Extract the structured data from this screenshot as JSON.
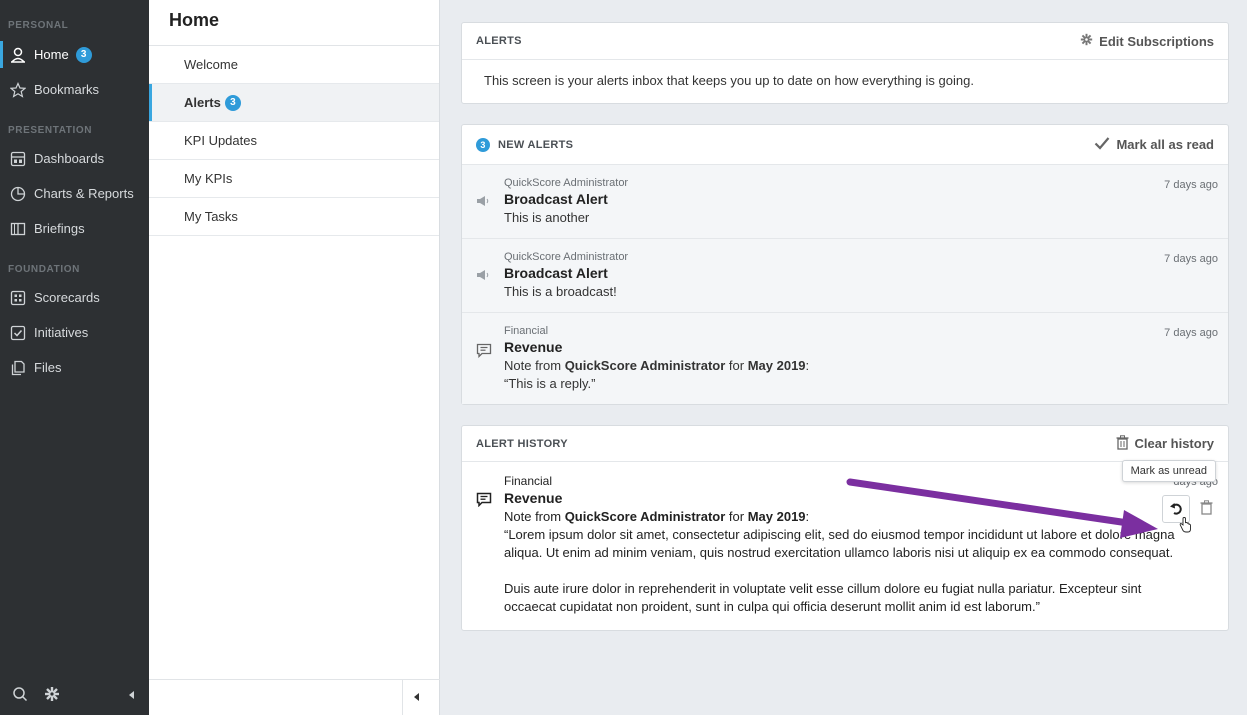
{
  "sidebar": {
    "sections": [
      {
        "label": "PERSONAL"
      },
      {
        "label": "PRESENTATION"
      },
      {
        "label": "FOUNDATION"
      }
    ],
    "items": [
      {
        "label": "Home",
        "icon": "user-icon",
        "badge": "3"
      },
      {
        "label": "Bookmarks",
        "icon": "star-icon"
      },
      {
        "label": "Dashboards",
        "icon": "dashboard-icon"
      },
      {
        "label": "Charts & Reports",
        "icon": "pie-chart-icon"
      },
      {
        "label": "Briefings",
        "icon": "book-icon"
      },
      {
        "label": "Scorecards",
        "icon": "scorecard-icon"
      },
      {
        "label": "Initiatives",
        "icon": "checkbox-icon"
      },
      {
        "label": "Files",
        "icon": "files-icon"
      }
    ]
  },
  "subnav": {
    "title": "Home",
    "items": [
      {
        "label": "Welcome"
      },
      {
        "label": "Alerts",
        "badge": "3"
      },
      {
        "label": "KPI Updates"
      },
      {
        "label": "My KPIs"
      },
      {
        "label": "My Tasks"
      }
    ]
  },
  "alerts_card": {
    "title": "ALERTS",
    "action": "Edit Subscriptions",
    "description": "This screen is your alerts inbox that keeps you up to date on how everything is going."
  },
  "new_alerts": {
    "count": "3",
    "title": "NEW ALERTS",
    "action": "Mark all as read",
    "items": [
      {
        "sender": "QuickScore Administrator",
        "title": "Broadcast Alert",
        "text": "This is another",
        "time": "7 days ago"
      },
      {
        "sender": "QuickScore Administrator",
        "title": "Broadcast Alert",
        "text": "This is a broadcast!",
        "time": "7 days ago"
      },
      {
        "sender": "Financial",
        "title": "Revenue",
        "note_prefix": "Note from ",
        "note_author": "QuickScore Administrator",
        "note_for": " for ",
        "note_period": "May 2019",
        "note_colon": ":",
        "quote": "“This is a reply.”",
        "time": "7 days ago"
      }
    ]
  },
  "history": {
    "title": "ALERT HISTORY",
    "action": "Clear history",
    "item": {
      "sender": "Financial",
      "title": "Revenue",
      "note_prefix": "Note from ",
      "note_author": "QuickScore Administrator",
      "note_for": " for ",
      "note_period": "May 2019",
      "note_colon": ":",
      "para1": "“Lorem ipsum dolor sit amet, consectetur adipiscing elit, sed do eiusmod tempor incididunt ut labore et dolore magna aliqua. Ut enim ad minim veniam, quis nostrud exercitation ullamco laboris nisi ut aliquip ex ea commodo consequat.",
      "para2": "Duis aute irure dolor in reprehenderit in voluptate velit esse cillum dolore eu fugiat nulla pariatur. Excepteur sint occaecat cupidatat non proident, sunt in culpa qui officia deserunt mollit anim id est laborum.”",
      "time_partial": "days ago"
    },
    "tooltip": "Mark as unread"
  },
  "colors": {
    "accent": "#2f9bd9",
    "sidebar_bg": "#2d3033",
    "annotation_arrow": "#7b2fa0"
  }
}
